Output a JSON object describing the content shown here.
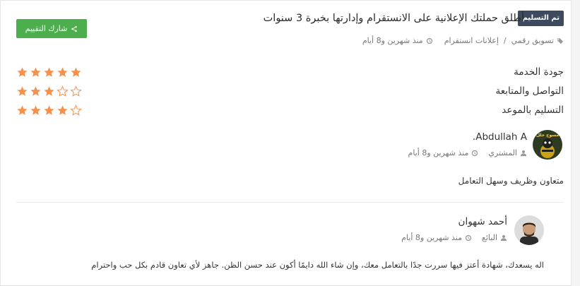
{
  "header": {
    "status_badge": "تم التسليم",
    "title": "أطلق حملتك الإعلانية على الانستقرام وإدارتها بخبرة 3 سنوات",
    "share_label": "شارك التقييم",
    "category": "تسويق رقمي",
    "subcategory": "إعلانات انستقرام",
    "time": "منذ شهرين و8 أيام"
  },
  "ratings": [
    {
      "label": "جودة الخدمة",
      "stars": 5
    },
    {
      "label": "التواصل والمتابعة",
      "stars": 3
    },
    {
      "label": "التسليم بالموعد",
      "stars": 4
    }
  ],
  "buyer_review": {
    "name": "Abdullah A.",
    "role": "المشتري",
    "time": "منذ شهرين و8 أيام",
    "text": "متعاون وظريف وسهل التعامل",
    "avatar_text": "مسوح حلل"
  },
  "seller_reply": {
    "name": "أحمد شهوان",
    "role": "البائع",
    "time": "منذ شهرين و8 أيام",
    "text": "اله يسعدك، شهادة أعتز فيها سررت جدًا بالتعامل معك، وإن شاء الله دايمًا أكون عند حسن الظن. جاهز لأي تعاون قادم بكل حب واحترام"
  },
  "colors": {
    "accent_green": "#4cae4c",
    "badge_dark": "#3e4a5e",
    "star_orange": "#f5914c"
  }
}
